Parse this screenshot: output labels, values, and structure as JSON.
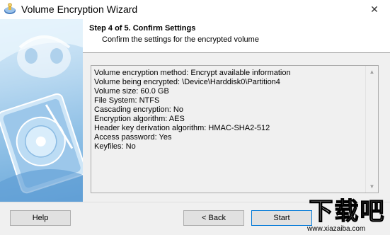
{
  "window": {
    "title": "Volume Encryption Wizard",
    "close_glyph": "✕",
    "icon": "app-key-icon"
  },
  "header": {
    "step_title": "Step 4 of 5. Confirm Settings",
    "step_subtitle": "Confirm the settings for the encrypted volume"
  },
  "summary": {
    "lines": [
      "Volume encryption method: Encrypt available information",
      "Volume being encrypted: \\Device\\Harddisk0\\Partition4",
      "Volume size: 60.0 GB",
      "File System: NTFS",
      "Cascading encryption: No",
      "Encryption algorithm: AES",
      "Header key derivation algorithm: HMAC-SHA2-512",
      "Access password: Yes",
      "Keyfiles: No"
    ]
  },
  "buttons": {
    "help": "Help",
    "back": "< Back",
    "start": "Start"
  },
  "watermark": {
    "logo_text": "下载吧",
    "url": "www.xiazaiba.com"
  },
  "colors": {
    "accent": "#0078d7",
    "panel_bg": "#f0f0f0"
  }
}
